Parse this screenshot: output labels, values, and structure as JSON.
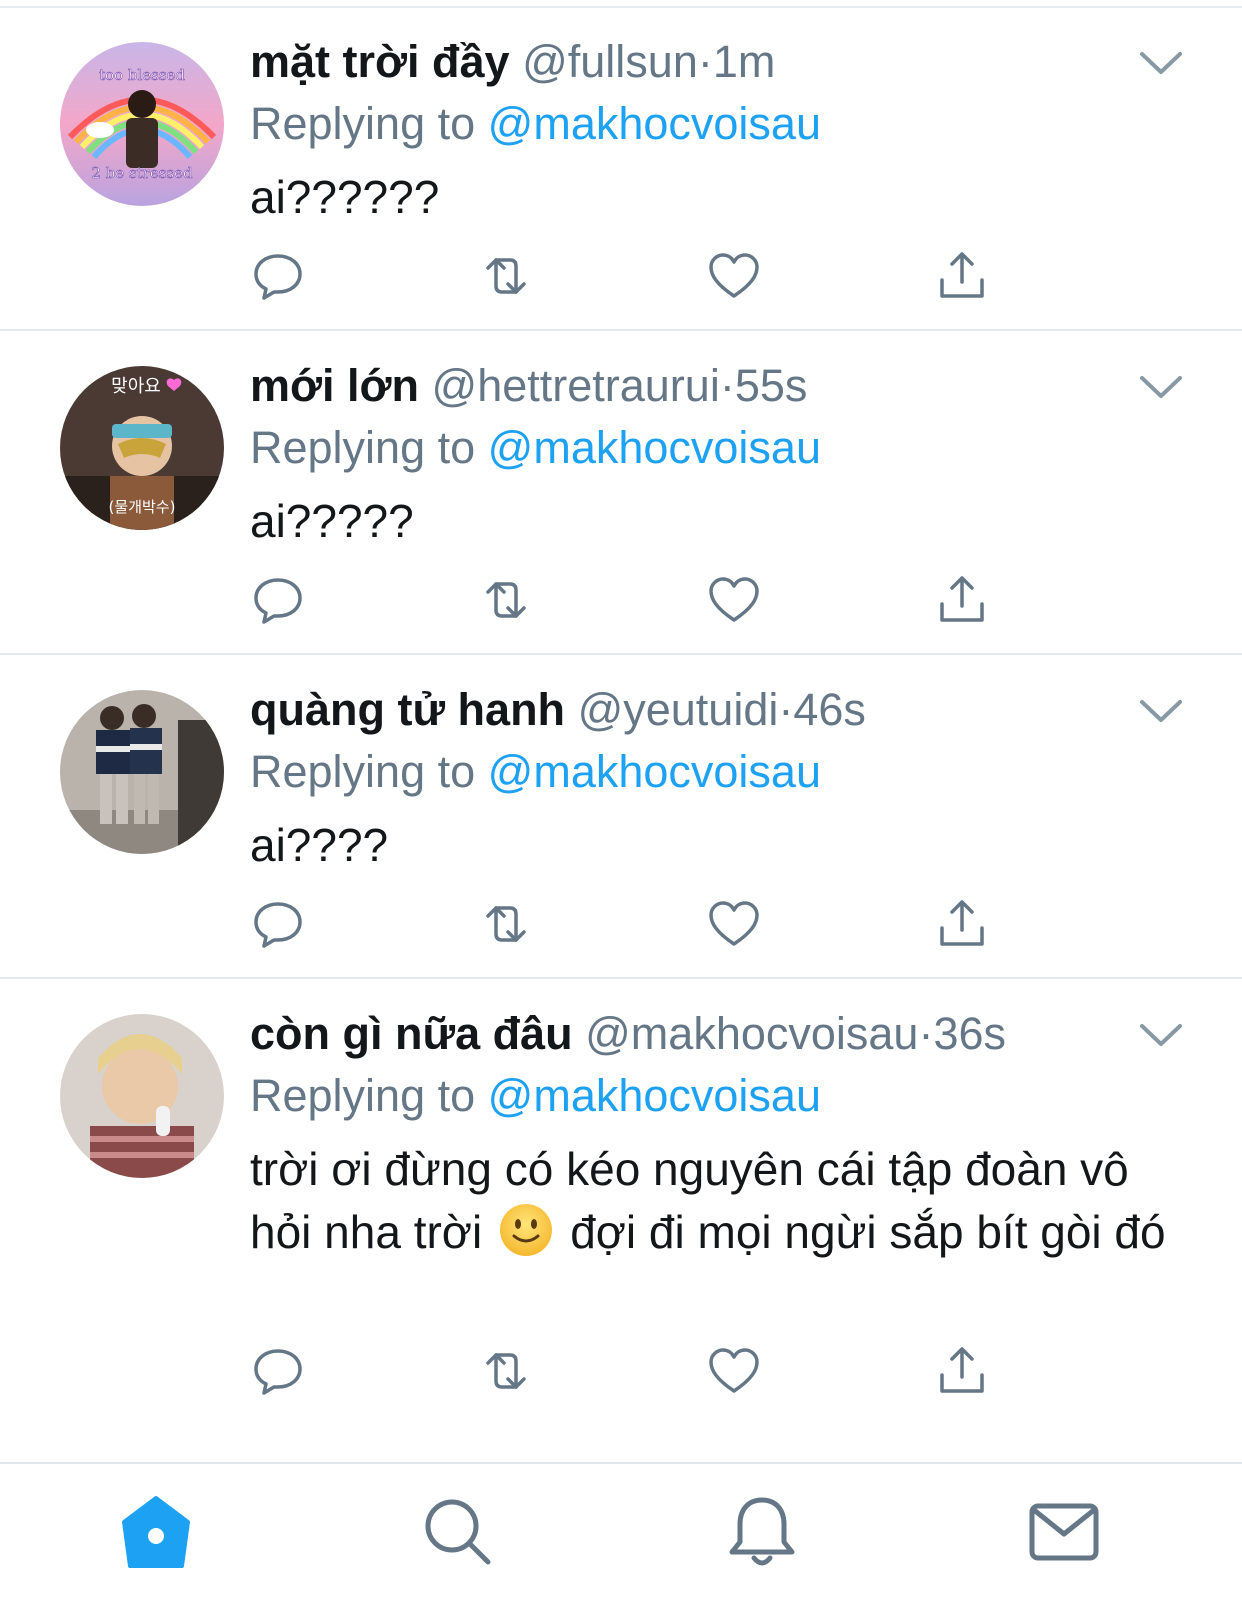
{
  "tweets": [
    {
      "name": "mặt trời đầy",
      "handle": "@fullsun",
      "separator": "·",
      "time": "1m",
      "replying_prefix": "Replying to",
      "replying_to": "@makhocvoisau",
      "text": "ai??????",
      "avatar_text_top": "too blessed",
      "avatar_text_bottom": "2 be stressed"
    },
    {
      "name": "mới lớn",
      "handle": "@hettretraurui",
      "separator": "·",
      "time": "55s",
      "replying_prefix": "Replying to",
      "replying_to": "@makhocvoisau",
      "text": "ai?????",
      "avatar_text_top": "맞아요",
      "avatar_text_bottom": "(물개박수)"
    },
    {
      "name": "quàng tử hanh",
      "handle": "@yeutuidi",
      "separator": "·",
      "time": "46s",
      "replying_prefix": "Replying to",
      "replying_to": "@makhocvoisau",
      "text": "ai????"
    },
    {
      "name": "còn gì nữa đâu",
      "handle": "@makhocvoisau",
      "separator": "·",
      "time": "36s",
      "replying_prefix": "Replying to",
      "replying_to": "@makhocvoisau",
      "text_part1": "trời ơi đừng có kéo nguyên cái tập đoàn vô hỏi nha trời",
      "text_emoji": "slightly-smiling-face-emoji",
      "text_part2": "đợi đi mọi ngừi sắp bít gòi đó"
    }
  ],
  "icons": {
    "reply": "reply-icon",
    "retweet": "retweet-icon",
    "like": "heart-icon",
    "share": "share-icon",
    "caret": "chevron-down-icon"
  },
  "tabbar": {
    "items": [
      "home-icon",
      "search-icon",
      "bell-icon",
      "mail-icon"
    ],
    "active": "home-icon"
  },
  "colors": {
    "accent": "#1da1f2",
    "secondary_text": "#657786",
    "divider": "#e1e8ed",
    "icon_gray": "#657786",
    "tab_active": "#1da1f2"
  }
}
